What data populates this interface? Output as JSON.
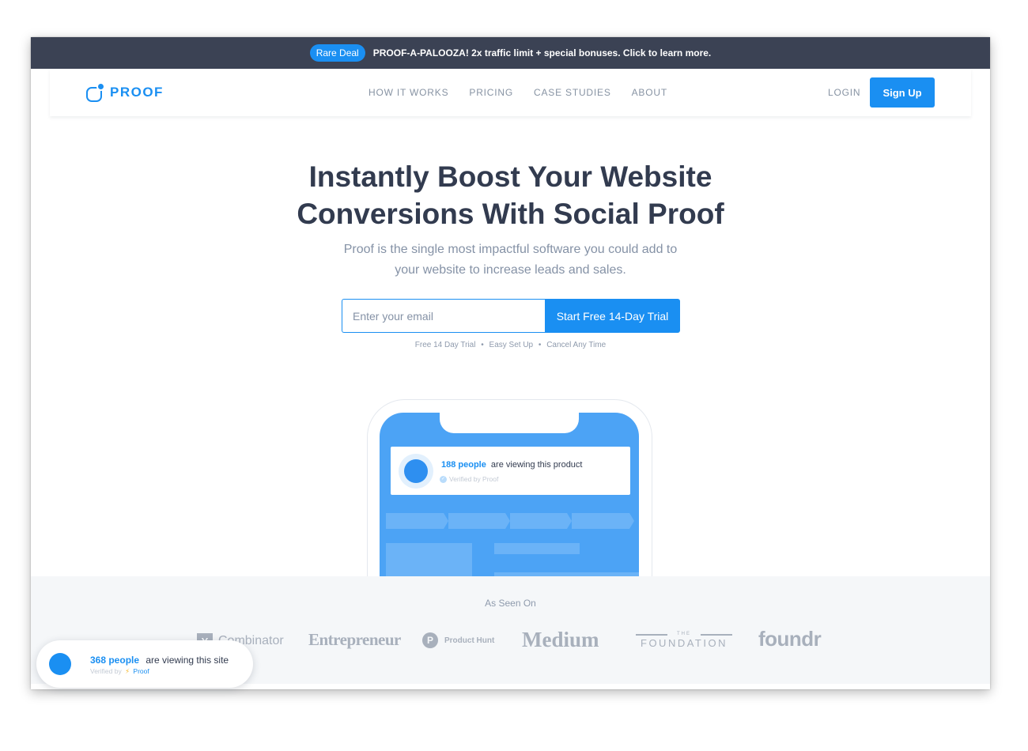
{
  "promo": {
    "badge": "Rare Deal",
    "message": "PROOF-A-PALOOZA!  2x traffic limit + special bonuses. Click to learn more."
  },
  "nav": {
    "logo_text": "PROOF",
    "items": [
      "HOW IT WORKS",
      "PRICING",
      "CASE STUDIES",
      "ABOUT"
    ],
    "login": "LOGIN",
    "signup": "Sign Up"
  },
  "hero": {
    "title_line1": "Instantly Boost Your Website",
    "title_line2": "Conversions With Social Proof",
    "subtitle_line1": "Proof is the single most impactful software you could add to",
    "subtitle_line2": "your website to increase leads and sales.",
    "email_placeholder": "Enter your email",
    "cta": "Start Free 14-Day Trial",
    "features": [
      "Free 14 Day Trial",
      "Easy Set Up",
      "Cancel Any Time"
    ],
    "separator": "•"
  },
  "phone_card": {
    "count": "188 people",
    "text": "are viewing this product",
    "verified": "Verified by Proof"
  },
  "seen_on": {
    "title": "As Seen On",
    "logos": {
      "yc_mark": "Y",
      "yc_text": "Combinator",
      "entrepreneur": "Entrepreneur",
      "ph_mark": "P",
      "product_hunt": "Product Hunt",
      "medium": "Medium",
      "foundation_the": "THE",
      "foundation": "FOUNDATION",
      "foundr": "foundr"
    }
  },
  "toast": {
    "count": "368 people",
    "text": "are viewing this site",
    "verified_prefix": "Verified by",
    "bolt": "⚡",
    "brand": "Proof"
  },
  "colors": {
    "primary": "#1a8ff2",
    "promo_bg": "#3b4254",
    "heading": "#323b4f",
    "muted": "#8592a6",
    "logo_gray": "#a8b0bc"
  }
}
